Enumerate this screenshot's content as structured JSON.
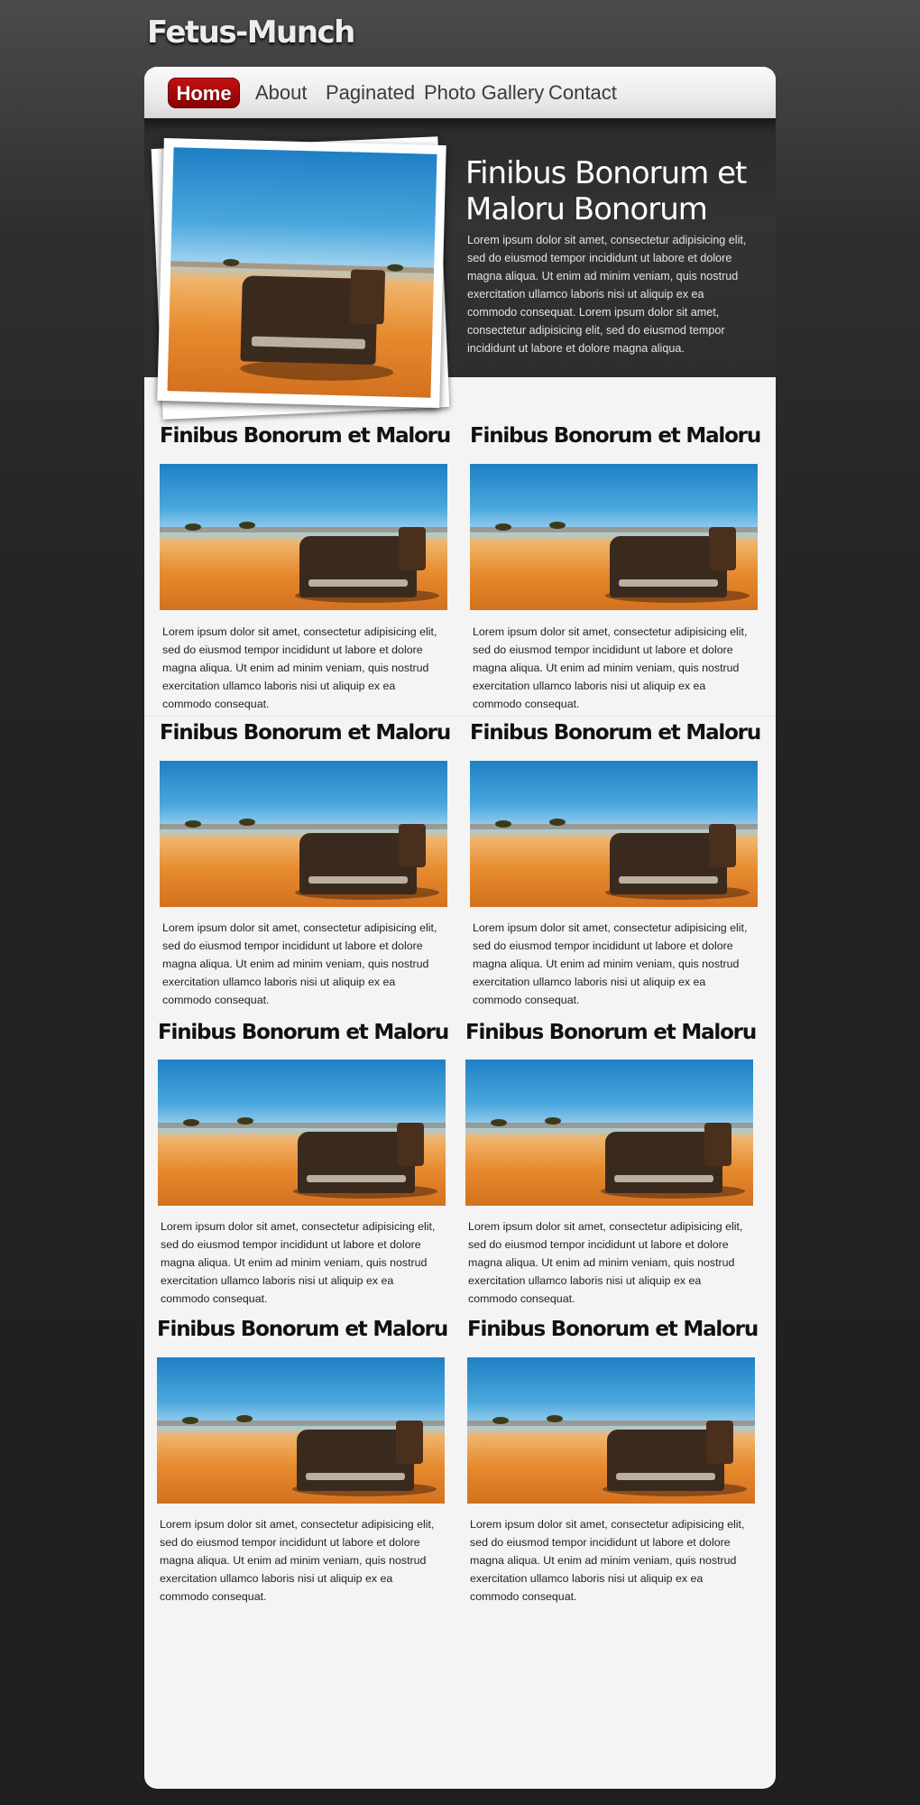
{
  "site": {
    "logo": "Fetus-Munch"
  },
  "nav": {
    "items": [
      {
        "label": "Home",
        "active": true
      },
      {
        "label": "About",
        "active": false
      },
      {
        "label": "Paginated",
        "active": false
      },
      {
        "label": "Photo Gallery",
        "active": false
      },
      {
        "label": "Contact",
        "active": false
      }
    ]
  },
  "featured": {
    "title": "Finibus Bonorum et Maloru Bonorum",
    "text": "Lorem ipsum dolor sit amet, consectetur adipisicing elit, sed do eiusmod tempor incididunt ut labore et dolore magna aliqua. Ut enim ad minim veniam, quis nostrud exercitation ullamco laboris nisi ut aliquip ex ea commodo consequat. Lorem ipsum dolor sit amet, consectetur adipisicing elit, sed do eiusmod tempor incididunt ut labore et dolore magna aliqua."
  },
  "posts": [
    {
      "title": "Finibus Bonorum et Maloru",
      "text": "Lorem ipsum dolor sit amet, consectetur adipisicing elit, sed do eiusmod tempor incididunt ut labore et dolore magna aliqua. Ut enim ad minim veniam, quis nostrud exercitation ullamco laboris nisi ut aliquip ex ea commodo consequat."
    },
    {
      "title": "Finibus Bonorum et Maloru",
      "text": "Lorem ipsum dolor sit amet, consectetur adipisicing elit, sed do eiusmod tempor incididunt ut labore et dolore magna aliqua. Ut enim ad minim veniam, quis nostrud exercitation ullamco laboris nisi ut aliquip ex ea commodo consequat."
    },
    {
      "title": "Finibus Bonorum et Maloru",
      "text": "Lorem ipsum dolor sit amet, consectetur adipisicing elit, sed do eiusmod tempor incididunt ut labore et dolore magna aliqua. Ut enim ad minim veniam, quis nostrud exercitation ullamco laboris nisi ut aliquip ex ea commodo consequat."
    },
    {
      "title": "Finibus Bonorum et Maloru",
      "text": "Lorem ipsum dolor sit amet, consectetur adipisicing elit, sed do eiusmod tempor incididunt ut labore et dolore magna aliqua. Ut enim ad minim veniam, quis nostrud exercitation ullamco laboris nisi ut aliquip ex ea commodo consequat."
    },
    {
      "title": "Finibus Bonorum et Maloru",
      "text": "Lorem ipsum dolor sit amet, consectetur adipisicing elit, sed do eiusmod tempor incididunt ut labore et dolore magna aliqua. Ut enim ad minim veniam, quis nostrud exercitation ullamco laboris nisi ut aliquip ex ea commodo consequat."
    },
    {
      "title": "Finibus Bonorum et Maloru",
      "text": "Lorem ipsum dolor sit amet, consectetur adipisicing elit, sed do eiusmod tempor incididunt ut labore et dolore magna aliqua. Ut enim ad minim veniam, quis nostrud exercitation ullamco laboris nisi ut aliquip ex ea commodo consequat."
    },
    {
      "title": "Finibus Bonorum et Maloru",
      "text": "Lorem ipsum dolor sit amet, consectetur adipisicing elit, sed do eiusmod tempor incididunt ut labore et dolore magna aliqua. Ut enim ad minim veniam, quis nostrud exercitation ullamco laboris nisi ut aliquip ex ea commodo consequat."
    },
    {
      "title": "Finibus Bonorum et Maloru",
      "text": "Lorem ipsum dolor sit amet, consectetur adipisicing elit, sed do eiusmod tempor incididunt ut labore et dolore magna aliqua. Ut enim ad minim veniam, quis nostrud exercitation ullamco laboris nisi ut aliquip ex ea commodo consequat."
    }
  ],
  "colors": {
    "accent": "#b00000",
    "hero_bg": "#2e2e2e",
    "content_bg": "#f4f4f4",
    "page_bg": "#232323"
  }
}
